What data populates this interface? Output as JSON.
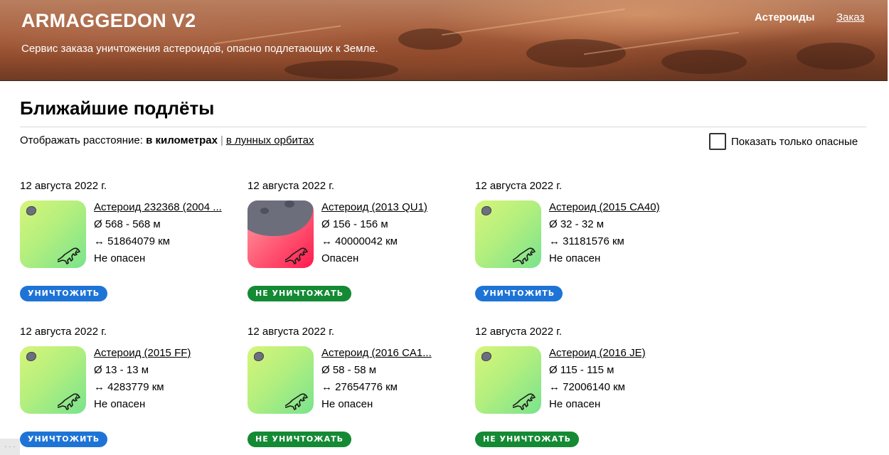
{
  "header": {
    "logo": "ARMAGGEDON V2",
    "subtitle": "Сервис заказа уничтожения астероидов, опасно подлетающих к Земле.",
    "nav": {
      "asteroids": "Астероиды",
      "order": "Заказ"
    }
  },
  "main": {
    "title": "Ближайшие подлёты",
    "distance": {
      "prefix": "Отображать расстояние:",
      "km": "в километрах",
      "separator": "|",
      "lunar": "в лунных орбитах"
    },
    "filter_label": "Показать только опасные"
  },
  "cards": [
    {
      "date": "12 августа 2022 г.",
      "name": "Астероид 232368 (2004 ...",
      "size": "Ø 568 - 568 м",
      "distance": "↔ 51864079 км",
      "status": "Не опасен",
      "button": "УНИЧТОЖИТЬ",
      "dangerous": false
    },
    {
      "date": "12 августа 2022 г.",
      "name": "Астероид (2013 QU1)",
      "size": "Ø 156 - 156 м",
      "distance": "↔ 40000042 км",
      "status": "Опасен",
      "button": "НЕ УНИЧТОЖАТЬ",
      "dangerous": true
    },
    {
      "date": "12 августа 2022 г.",
      "name": "Астероид (2015 CA40)",
      "size": "Ø 32 - 32 м",
      "distance": "↔ 31181576 км",
      "status": "Не опасен",
      "button": "УНИЧТОЖИТЬ",
      "dangerous": false
    },
    {
      "date": "12 августа 2022 г.",
      "name": "Астероид (2015 FF)",
      "size": "Ø 13 - 13 м",
      "distance": "↔ 4283779 км",
      "status": "Не опасен",
      "button": "УНИЧТОЖИТЬ",
      "dangerous": false
    },
    {
      "date": "12 августа 2022 г.",
      "name": "Астероид (2016 CA1...",
      "size": "Ø 58 - 58 м",
      "distance": "↔ 27654776 км",
      "status": "Не опасен",
      "button": "НЕ УНИЧТОЖАТЬ",
      "dangerous": false
    },
    {
      "date": "12 августа 2022 г.",
      "name": "Астероид (2016 JE)",
      "size": "Ø 115 - 115 м",
      "distance": "↔ 72006140 км",
      "status": "Не опасен",
      "button": "НЕ УНИЧТОЖАТЬ",
      "dangerous": false
    }
  ],
  "colors": {
    "destroy": "#1e74d6",
    "keep": "#148a34",
    "safe_thumb": "#b4ef7e",
    "danger_thumb": "#ff5773"
  },
  "icons": {
    "asteroid": "asteroid-icon",
    "dino": "dinosaur-icon",
    "checkbox": "checkbox-icon"
  }
}
